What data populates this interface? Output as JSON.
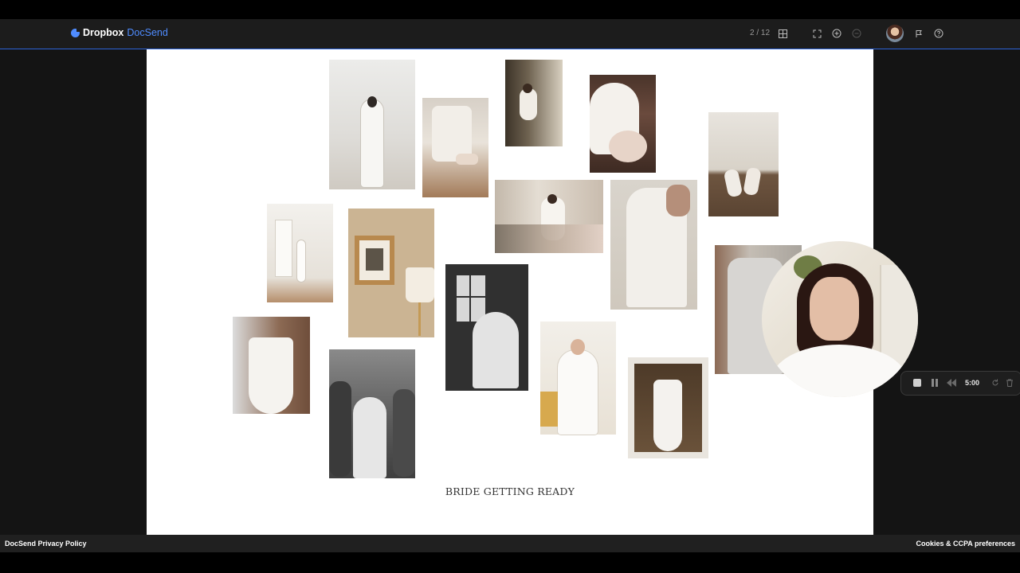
{
  "header": {
    "brand_primary": "Dropbox",
    "brand_secondary": "DocSend",
    "page_indicator": "2 / 12",
    "icons": [
      "grid-icon",
      "fullscreen-icon",
      "plus-circle-icon",
      "minus-circle-icon",
      "avatar",
      "flag-icon",
      "help-icon"
    ]
  },
  "slide": {
    "caption": "BRIDE GETTING READY",
    "photos": [
      {
        "name": "photo-bride-veil-window",
        "tone": "#d8d8d6"
      },
      {
        "name": "photo-bride-shoes-buckle",
        "tone": "#cfc2b0"
      },
      {
        "name": "photo-bride-mirror-makeup",
        "tone": "#6b5f4c"
      },
      {
        "name": "photo-bride-bouquet-shoulder",
        "tone": "#6a4a3d"
      },
      {
        "name": "photo-bridal-shoes-floor",
        "tone": "#a08970"
      },
      {
        "name": "photo-bride-hallway",
        "tone": "#e6e2da"
      },
      {
        "name": "photo-framed-art-lamp",
        "tone": "#c8b08a"
      },
      {
        "name": "photo-bride-seated-flowers",
        "tone": "#b8a99a"
      },
      {
        "name": "photo-pearl-sleeve-gown",
        "tone": "#cdc7bf"
      },
      {
        "name": "photo-bride-window-bw",
        "tone": "#3d3d3d"
      },
      {
        "name": "photo-corset-dress-back",
        "tone": "#8a6a55"
      },
      {
        "name": "photo-bridesmaids-dressing-bw",
        "tone": "#5a5a5a"
      },
      {
        "name": "photo-bride-robe-smiling",
        "tone": "#efe9e0"
      },
      {
        "name": "photo-dress-hanging-wall",
        "tone": "#5b4632"
      },
      {
        "name": "photo-bride-satin-dress",
        "tone": "#b7b3ad"
      }
    ]
  },
  "recorder": {
    "time": "5:00",
    "buttons": [
      "stop-button",
      "pause-button",
      "rewind-button",
      "redo-button",
      "delete-button"
    ]
  },
  "footer": {
    "privacy": "DocSend Privacy Policy",
    "cookies": "Cookies & CCPA preferences"
  }
}
